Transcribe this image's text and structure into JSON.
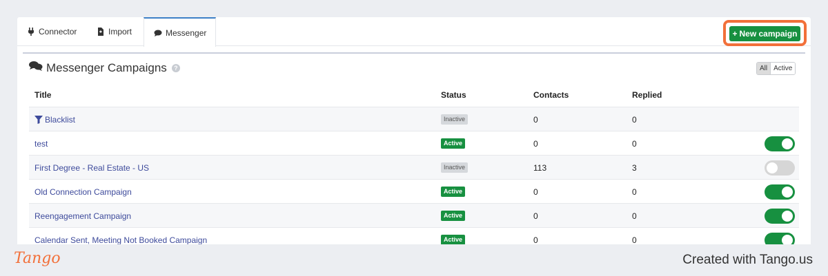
{
  "tabs": [
    {
      "label": "Connector",
      "icon": "plug-icon"
    },
    {
      "label": "Import",
      "icon": "file-import-icon"
    },
    {
      "label": "Messenger",
      "icon": "chat-bubble-icon"
    }
  ],
  "actions": {
    "new_campaign_label": "New campaign"
  },
  "section": {
    "title": "Messenger Campaigns",
    "help_glyph": "?"
  },
  "filters": {
    "all_label": "All",
    "active_label": "Active"
  },
  "table": {
    "columns": [
      "Title",
      "Status",
      "Contacts",
      "Replied"
    ],
    "rows": [
      {
        "title": "Blacklist",
        "status": "Inactive",
        "contacts": "0",
        "replied": "0"
      },
      {
        "title": "test",
        "status": "Active",
        "contacts": "0",
        "replied": "0"
      },
      {
        "title": "First Degree - Real Estate - US",
        "status": "Inactive",
        "contacts": "113",
        "replied": "3"
      },
      {
        "title": "Old Connection Campaign",
        "status": "Active",
        "contacts": "0",
        "replied": "0"
      },
      {
        "title": "Reengagement Campaign",
        "status": "Active",
        "contacts": "0",
        "replied": "0"
      },
      {
        "title": "Calendar Sent, Meeting Not Booked Campaign",
        "status": "Active",
        "contacts": "0",
        "replied": "0"
      }
    ]
  },
  "footer": {
    "brand": "Tango",
    "created_with": "Created with Tango.us"
  },
  "colors": {
    "accent_green": "#179040",
    "highlight_orange": "#f2703a",
    "link_blue": "#3d4a9b"
  }
}
